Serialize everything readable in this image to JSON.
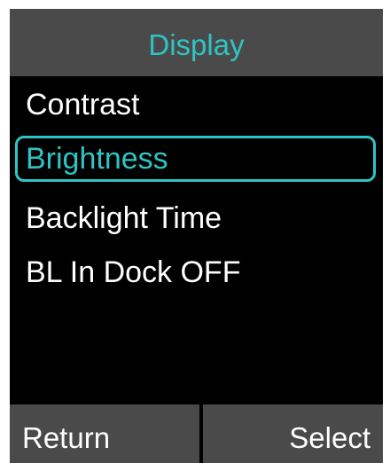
{
  "header": {
    "title": "Display"
  },
  "menu": {
    "items": [
      {
        "label": "Contrast",
        "selected": false
      },
      {
        "label": "Brightness",
        "selected": true
      },
      {
        "label": "Backlight Time",
        "selected": false
      },
      {
        "label": "BL In Dock OFF",
        "selected": false
      }
    ]
  },
  "softkeys": {
    "left": "Return",
    "right": "Select"
  },
  "colors": {
    "accent": "#2ec4c4",
    "bar": "#4a4a4a",
    "background": "#000000",
    "text": "#ffffff"
  }
}
